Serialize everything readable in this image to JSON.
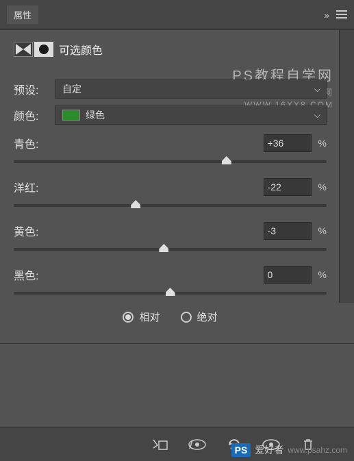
{
  "panel": {
    "title": "属性",
    "name": "可选颜色"
  },
  "watermark": {
    "line1": "PS教程自学网",
    "line2": "学PS，就到PS教程自学网",
    "line3": "WWW.16XX8.COM"
  },
  "preset": {
    "label": "预设:",
    "value": "自定"
  },
  "color": {
    "label": "颜色:",
    "value": "绿色",
    "swatch": "#2a8c2a"
  },
  "sliders": [
    {
      "label": "青色:",
      "value": "+36",
      "pos": 68
    },
    {
      "label": "洋红:",
      "value": "-22",
      "pos": 39
    },
    {
      "label": "黄色:",
      "value": "-3",
      "pos": 48
    },
    {
      "label": "黑色:",
      "value": "0",
      "pos": 50
    }
  ],
  "method": {
    "relative": "相对",
    "absolute": "绝对",
    "selected": "relative"
  },
  "pct": "%",
  "bottom_wm": {
    "badge": "PS",
    "suffix": "爱好者",
    "url": "www.psahz.com"
  }
}
